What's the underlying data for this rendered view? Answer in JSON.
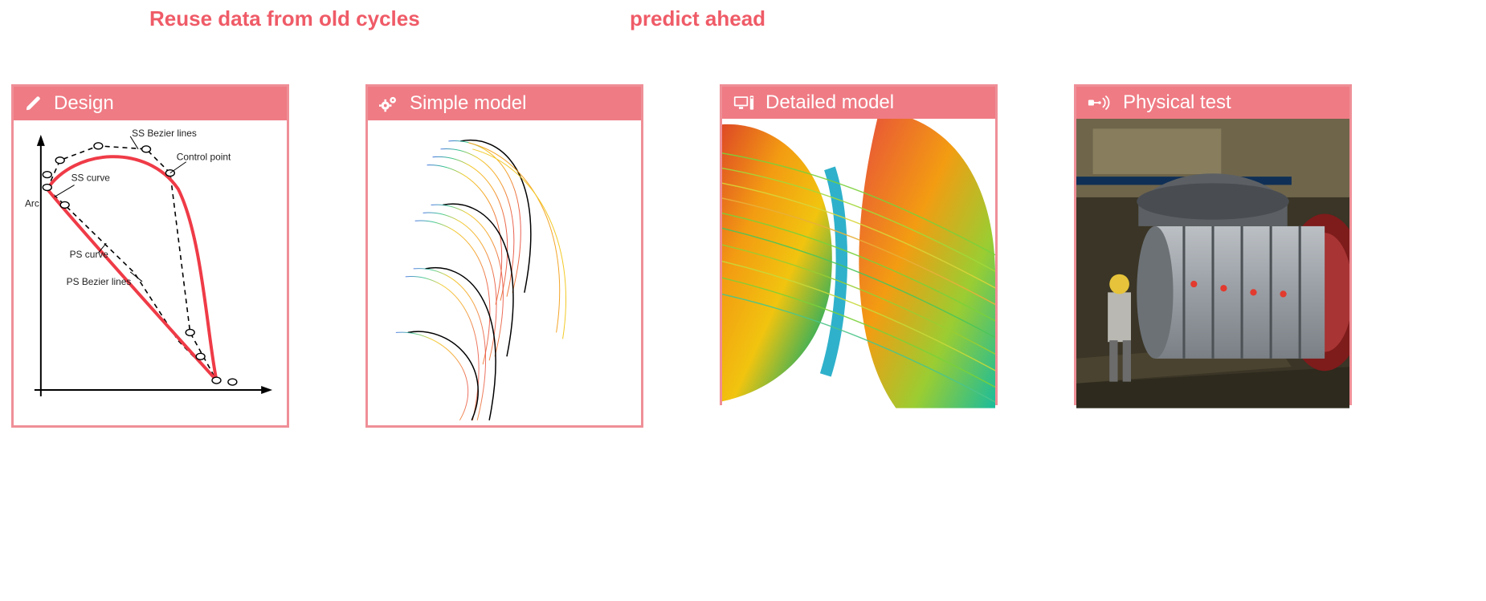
{
  "top_labels": {
    "reuse": "Reuse data from old cycles",
    "predict": "predict ahead"
  },
  "cards": [
    {
      "id": "design",
      "title": "Design",
      "icon": "pencil-icon",
      "annotations": {
        "ss_bezier": "SS Bezier lines",
        "control_point": "Control point",
        "ss_curve": "SS curve",
        "arc": "Arc",
        "ps_curve": "PS curve",
        "ps_bezier": "PS Bezier lines"
      }
    },
    {
      "id": "simple",
      "title": "Simple model",
      "icon": "gears-icon"
    },
    {
      "id": "detailed",
      "title": "Detailed model",
      "icon": "monitor-icon"
    },
    {
      "id": "physical",
      "title": "Physical test",
      "icon": "sensor-icon"
    }
  ],
  "colors": {
    "accent": "#ef7b84",
    "accent_border": "#ef8f97",
    "text_accent": "#ef5b67"
  }
}
